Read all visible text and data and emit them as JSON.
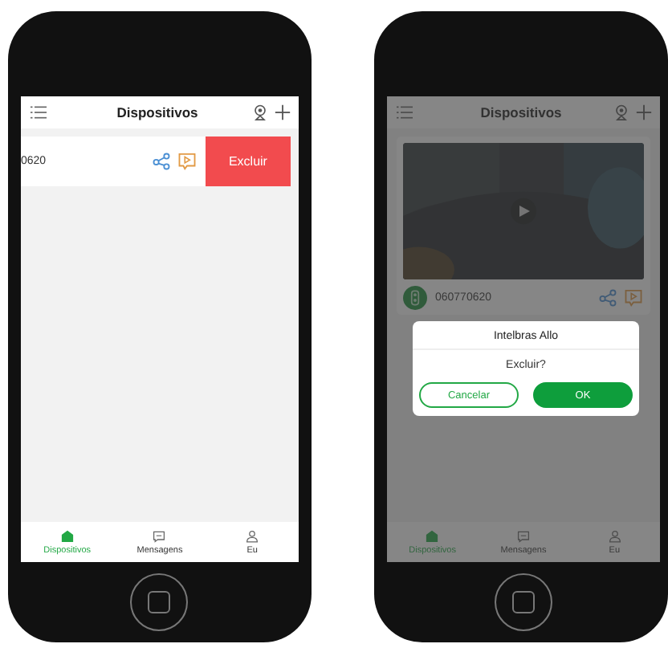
{
  "screens": [
    {
      "kind": "swiped",
      "header": {
        "title": "Dispositivos"
      },
      "device": {
        "name": "0620",
        "delete_label": "Excluir"
      },
      "nav": [
        {
          "label": "Dispositivos",
          "selected": true
        },
        {
          "label": "Mensagens",
          "selected": false
        },
        {
          "label": "Eu",
          "selected": false
        }
      ]
    },
    {
      "kind": "dialog",
      "header": {
        "title": "Dispositivos"
      },
      "device": {
        "name": "060770620"
      },
      "dialog": {
        "title": "Intelbras Allo",
        "message": "Excluir?",
        "cancel": "Cancelar",
        "ok": "OK"
      },
      "nav": [
        {
          "label": "Dispositivos",
          "selected": true
        },
        {
          "label": "Mensagens",
          "selected": false
        },
        {
          "label": "Eu",
          "selected": false
        }
      ]
    }
  ]
}
